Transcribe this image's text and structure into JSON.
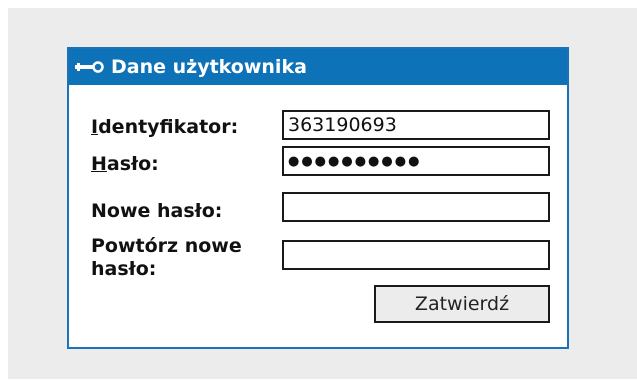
{
  "panel": {
    "title": "Dane użytkownika",
    "icon": "key-icon"
  },
  "form": {
    "identifier": {
      "label_access_key": "I",
      "label_rest": "dentyfikator:",
      "value": "363190693"
    },
    "password": {
      "label_access_key": "H",
      "label_rest": "asło:",
      "masked_value": "●●●●●●●●●●"
    },
    "new_password": {
      "label": "Nowe hasło:",
      "value": ""
    },
    "repeat_password": {
      "label_line1": "Powtórz nowe",
      "label_line2": "hasło:",
      "value": ""
    },
    "submit_label": "Zatwierdź"
  },
  "colors": {
    "header": "#0e72b9",
    "border": "#1a72b8",
    "backdrop": "#ececec"
  }
}
